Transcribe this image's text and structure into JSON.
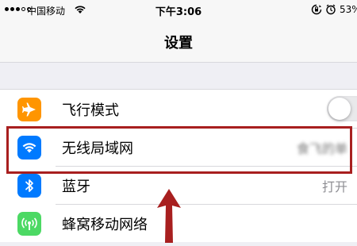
{
  "status_bar": {
    "carrier": "中国移动",
    "time": "下午3:06",
    "battery": "53%",
    "icons": [
      "signal-dots",
      "wifi-icon",
      "orientation-lock-icon",
      "alarm-icon"
    ]
  },
  "nav": {
    "title": "设置"
  },
  "settings": {
    "items": [
      {
        "label": "飞行模式",
        "icon": "airplane-icon",
        "icon_bg": "#ff9500",
        "control": "toggle",
        "toggle_on": false
      },
      {
        "label": "无线局域网",
        "icon": "wifi-icon",
        "icon_bg": "#007aff",
        "value": "食飞的单"
      },
      {
        "label": "蓝牙",
        "icon": "bluetooth-icon",
        "icon_bg": "#007aff",
        "value": "打开"
      },
      {
        "label": "蜂窝移动网络",
        "icon": "cellular-icon",
        "icon_bg": "#4cd964"
      }
    ]
  },
  "annotation": {
    "highlight_color": "#a81f1f",
    "highlight_target": "无线局域网",
    "arrow": "up"
  }
}
